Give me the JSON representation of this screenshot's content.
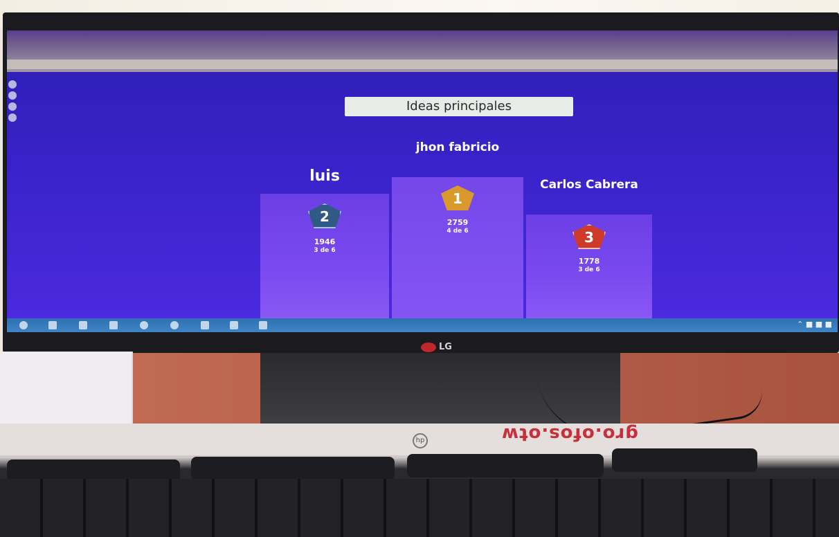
{
  "slide": {
    "title": "Ideas principales"
  },
  "podium": [
    {
      "rank": "2",
      "name": "luis",
      "score": "1946",
      "progress": "3 de 6",
      "badge_color": "#2f5a86"
    },
    {
      "rank": "1",
      "name": "jhon fabricio",
      "score": "2759",
      "progress": "4 de 6",
      "badge_color": "#d99a2b"
    },
    {
      "rank": "3",
      "name": "Carlos Cabrera",
      "score": "1778",
      "progress": "3 de 6",
      "badge_color": "#cf3b2b"
    }
  ],
  "monitor": {
    "brand": "LG"
  },
  "keyboard": {
    "sticker": "gro.ofos.otw"
  },
  "colors": {
    "screen_bg": "#3a22c9",
    "podium": "#7a4af0",
    "taskbar": "#3f86c6"
  }
}
